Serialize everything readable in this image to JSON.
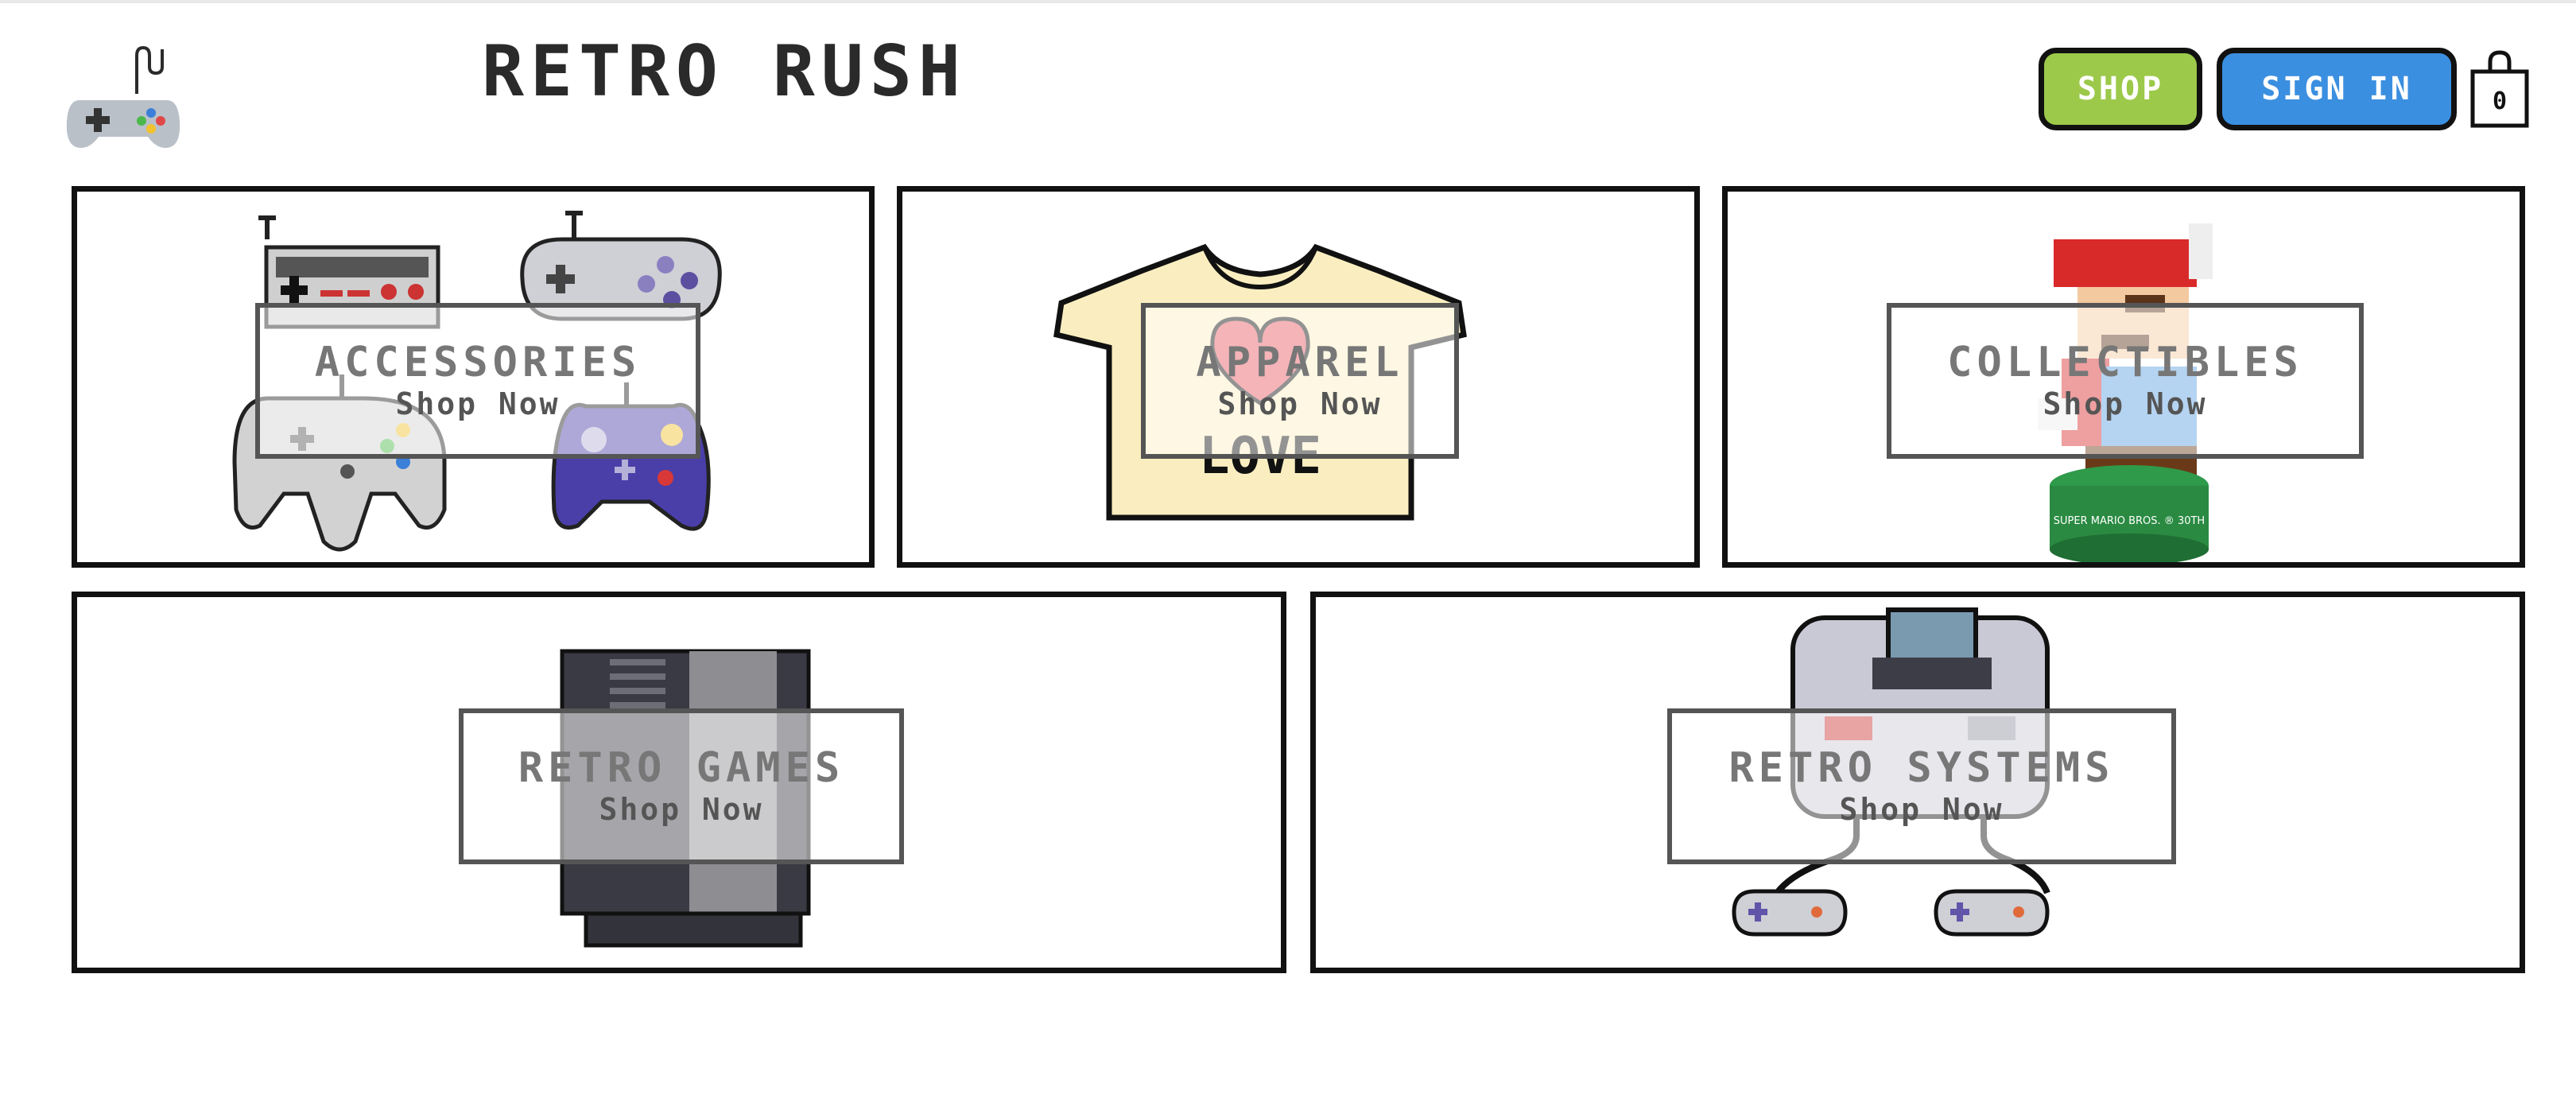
{
  "header": {
    "brand": "RETRO RUSH",
    "logo_icon": "gamepad-icon",
    "shop_label": "SHOP",
    "signin_label": "SIGN IN",
    "cart_icon": "shopping-bag-icon",
    "cart_count": "0"
  },
  "colors": {
    "shop_button": "#9cc94a",
    "signin_button": "#3b8fe0",
    "border": "#111111"
  },
  "categories": [
    {
      "title": "ACCESSORIES",
      "cta": "Shop Now",
      "icon": "controllers-icon"
    },
    {
      "title": "APPAREL",
      "cta": "Shop Now",
      "icon": "tshirt-icon",
      "shirt_text": "LOVE"
    },
    {
      "title": "COLLECTIBLES",
      "cta": "Shop Now",
      "icon": "mario-figure-icon",
      "base_text": "SUPER MARIO BROS. ® 30TH"
    },
    {
      "title": "RETRO GAMES",
      "cta": "Shop Now",
      "icon": "game-cartridge-icon"
    },
    {
      "title": "RETRO SYSTEMS",
      "cta": "Shop Now",
      "icon": "console-icon"
    }
  ]
}
